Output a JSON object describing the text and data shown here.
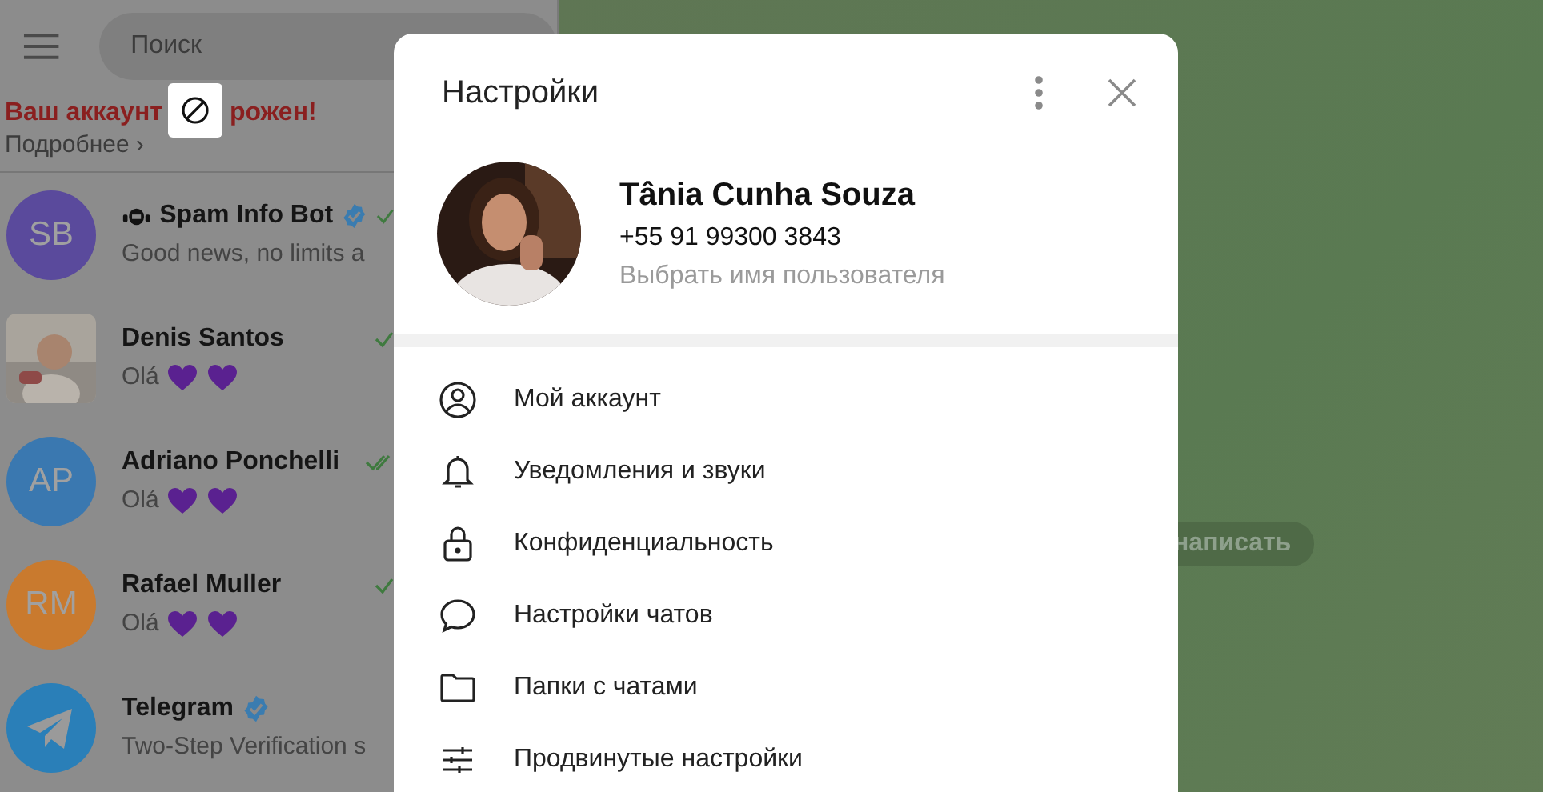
{
  "sidebar": {
    "search": {
      "placeholder": "Поиск"
    },
    "banner": {
      "title_start": "Ваш аккаунт",
      "title_end": "рожен!",
      "link": "Подробнее ›"
    },
    "chats": [
      {
        "name": "Spam Info Bot",
        "initials": "SB",
        "color": "#5a4a9c",
        "bot": true,
        "verified": true,
        "preview": "Good news, no limits a",
        "hearts": false,
        "read": false
      },
      {
        "name": "Denis Santos",
        "kind": "picture",
        "bot": false,
        "verified": false,
        "preview": "Olá",
        "hearts": true,
        "read": false
      },
      {
        "name": "Adriano Ponchelli",
        "initials": "AP",
        "color": "#3a78b0",
        "bot": false,
        "verified": false,
        "preview": "Olá",
        "hearts": true,
        "read": true
      },
      {
        "name": "Rafael Muller",
        "initials": "RM",
        "color": "#c97a2e",
        "bot": false,
        "verified": false,
        "preview": "Olá",
        "hearts": true,
        "read": false
      },
      {
        "name": "Telegram",
        "kind": "logo",
        "color": "#2a7fb8",
        "bot": false,
        "verified": true,
        "preview": "Two-Step Verification s",
        "hearts": false
      }
    ]
  },
  "main": {
    "hint": "написать"
  },
  "settings": {
    "title": "Настройки",
    "profile": {
      "name": "Tânia Cunha Souza",
      "phone": "+55 91 99300 3843",
      "username_hint": "Выбрать имя пользователя"
    },
    "items": [
      {
        "kind": "account",
        "label": "Мой аккаунт"
      },
      {
        "kind": "bell",
        "label": "Уведомления и звуки"
      },
      {
        "kind": "lock",
        "label": "Конфиденциальность"
      },
      {
        "kind": "chat",
        "label": "Настройки чатов"
      },
      {
        "kind": "folder",
        "label": "Папки с чатами"
      },
      {
        "kind": "sliders",
        "label": "Продвинутые настройки"
      }
    ]
  }
}
